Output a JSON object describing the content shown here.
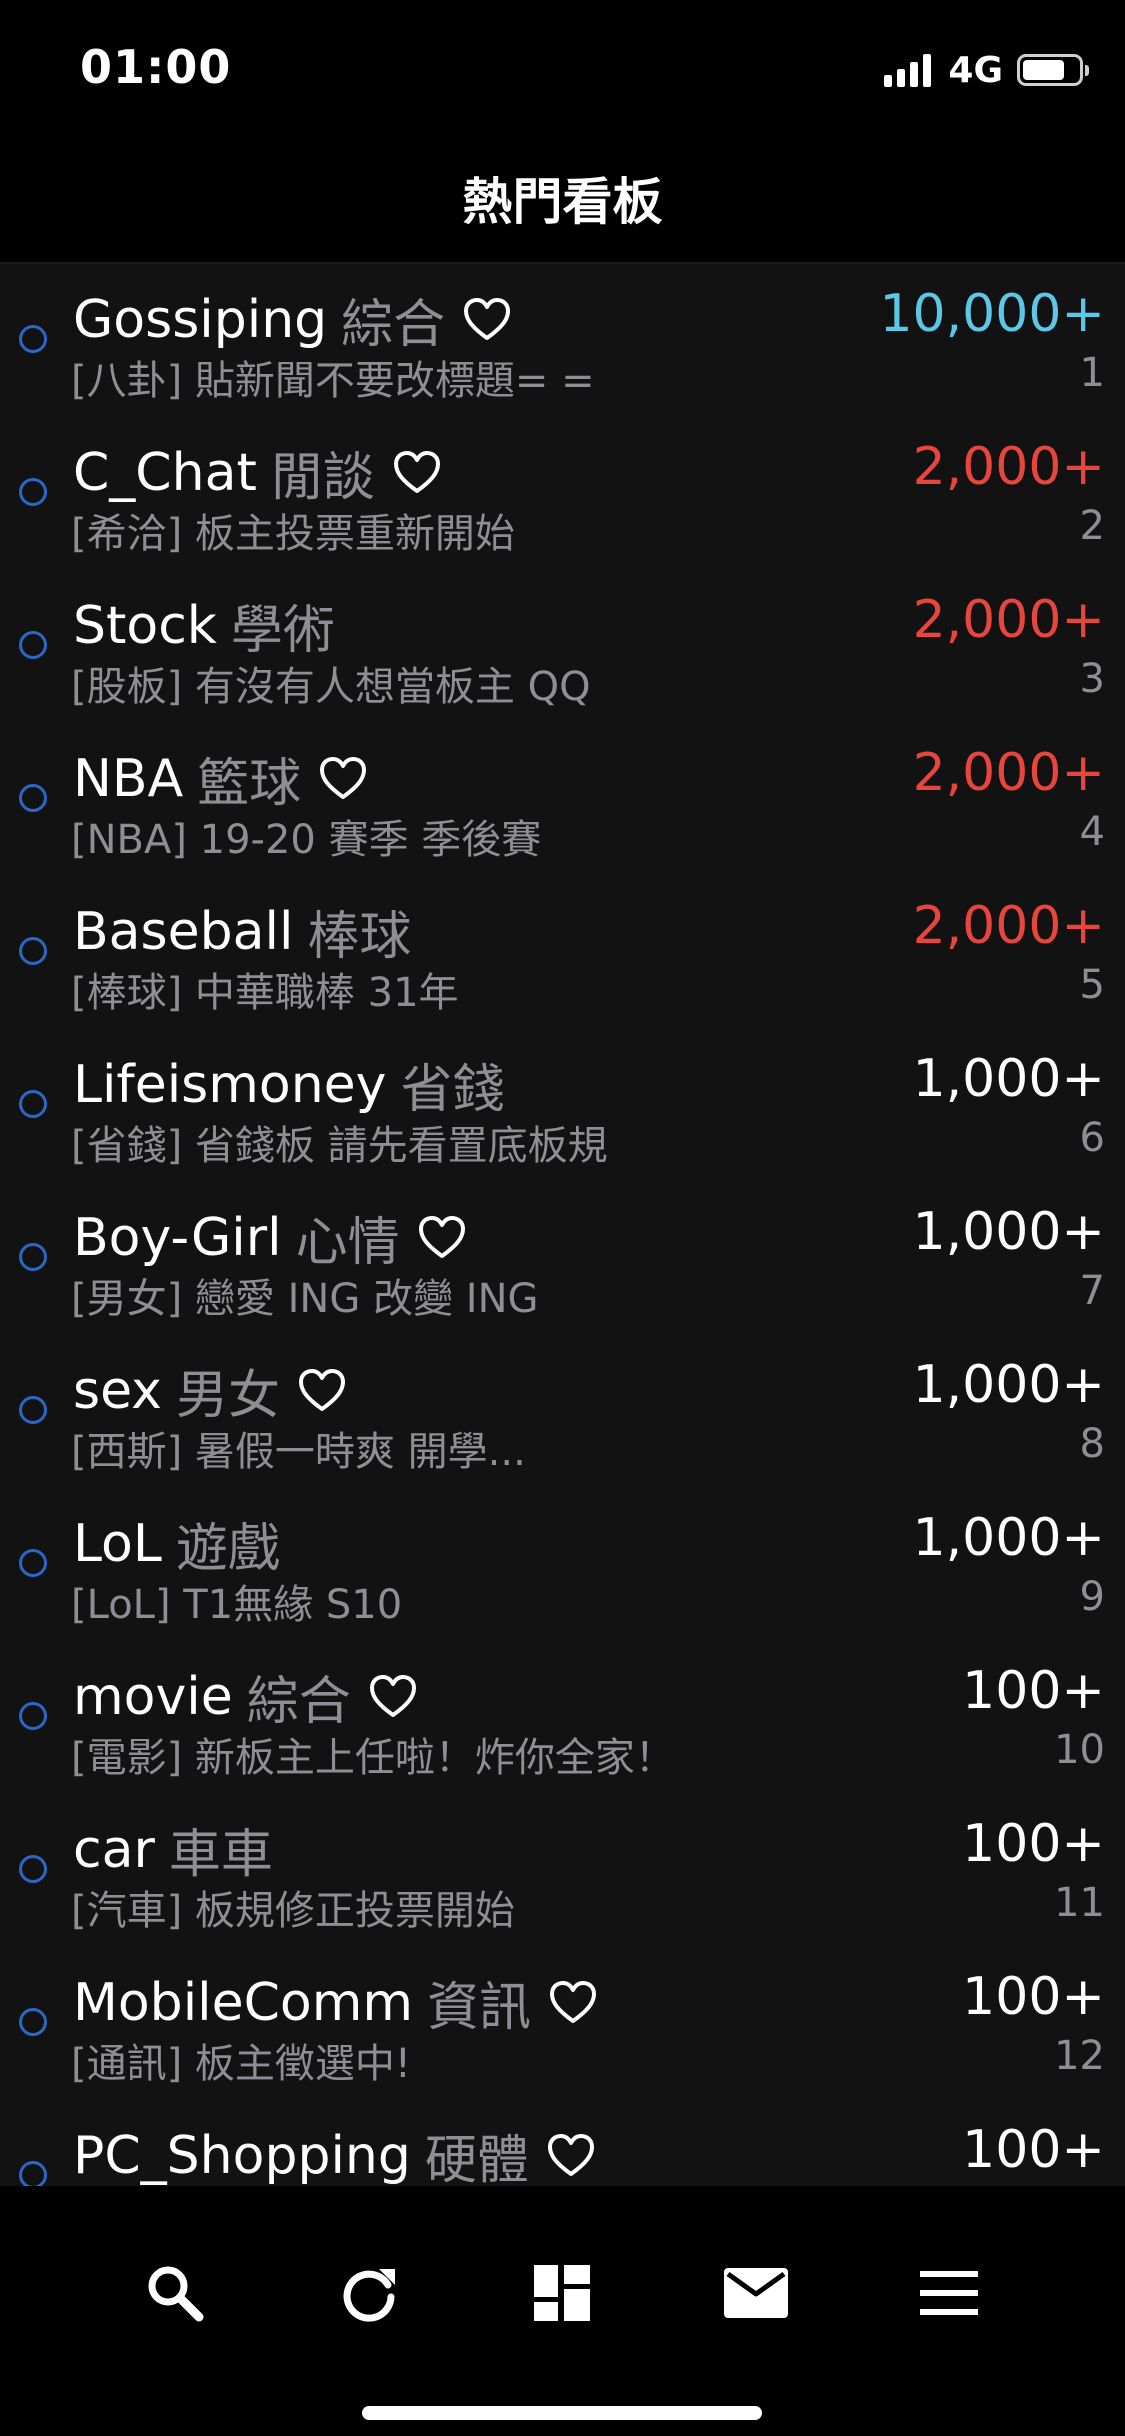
{
  "status_bar": {
    "time": "01:00",
    "network": "4G",
    "battery_level": 0.75
  },
  "header": {
    "title": "熱門看板"
  },
  "colors": {
    "popularity_cyan": "#5ac8e6",
    "popularity_red": "#e8463d",
    "popularity_white": "#ffffff",
    "unread_ring": "#2a68c8"
  },
  "boards": [
    {
      "name": "Gossiping",
      "category": "綜合",
      "favorite": true,
      "desc": "[八卦] 貼新聞不要改標題= =",
      "popularity": "10,000+",
      "rank": "1",
      "pop_color": "#5ac8e6"
    },
    {
      "name": "C_Chat",
      "category": "閒談",
      "favorite": true,
      "desc": "[希洽] 板主投票重新開始",
      "popularity": "2,000+",
      "rank": "2",
      "pop_color": "#e8463d"
    },
    {
      "name": "Stock",
      "category": "學術",
      "favorite": false,
      "desc": "[股板] 有沒有人想當板主 QQ",
      "popularity": "2,000+",
      "rank": "3",
      "pop_color": "#e8463d"
    },
    {
      "name": "NBA",
      "category": "籃球",
      "favorite": true,
      "desc": "[NBA] 19-20 賽季 季後賽",
      "popularity": "2,000+",
      "rank": "4",
      "pop_color": "#e8463d"
    },
    {
      "name": "Baseball",
      "category": "棒球",
      "favorite": false,
      "desc": "[棒球] 中華職棒 31年",
      "popularity": "2,000+",
      "rank": "5",
      "pop_color": "#e8463d"
    },
    {
      "name": "Lifeismoney",
      "category": "省錢",
      "favorite": false,
      "desc": "[省錢] 省錢板 請先看置底板規",
      "popularity": "1,000+",
      "rank": "6",
      "pop_color": "#ffffff"
    },
    {
      "name": "Boy-Girl",
      "category": "心情",
      "favorite": true,
      "desc": "[男女] 戀愛 ING 改變 ING",
      "popularity": "1,000+",
      "rank": "7",
      "pop_color": "#ffffff"
    },
    {
      "name": "sex",
      "category": "男女",
      "favorite": true,
      "desc": "[西斯] 暑假一時爽 開學...",
      "popularity": "1,000+",
      "rank": "8",
      "pop_color": "#ffffff"
    },
    {
      "name": "LoL",
      "category": "遊戲",
      "favorite": false,
      "desc": "[LoL] T1無緣 S10",
      "popularity": "1,000+",
      "rank": "9",
      "pop_color": "#ffffff"
    },
    {
      "name": "movie",
      "category": "綜合",
      "favorite": true,
      "desc": "[電影] 新板主上任啦！炸你全家！",
      "popularity": "100+",
      "rank": "10",
      "pop_color": "#ffffff"
    },
    {
      "name": "car",
      "category": "車車",
      "favorite": false,
      "desc": "[汽車] 板規修正投票開始",
      "popularity": "100+",
      "rank": "11",
      "pop_color": "#ffffff"
    },
    {
      "name": "MobileComm",
      "category": "資訊",
      "favorite": true,
      "desc": "[通訊] 板主徵選中!",
      "popularity": "100+",
      "rank": "12",
      "pop_color": "#ffffff"
    },
    {
      "name": "PC_Shopping",
      "category": "硬體",
      "favorite": true,
      "desc": "",
      "popularity": "100+",
      "rank": "",
      "pop_color": "#ffffff"
    }
  ],
  "tab_bar": {
    "tabs": [
      {
        "icon": "search-icon"
      },
      {
        "icon": "refresh-icon"
      },
      {
        "icon": "dashboard-icon"
      },
      {
        "icon": "mail-icon"
      },
      {
        "icon": "menu-icon"
      }
    ]
  }
}
